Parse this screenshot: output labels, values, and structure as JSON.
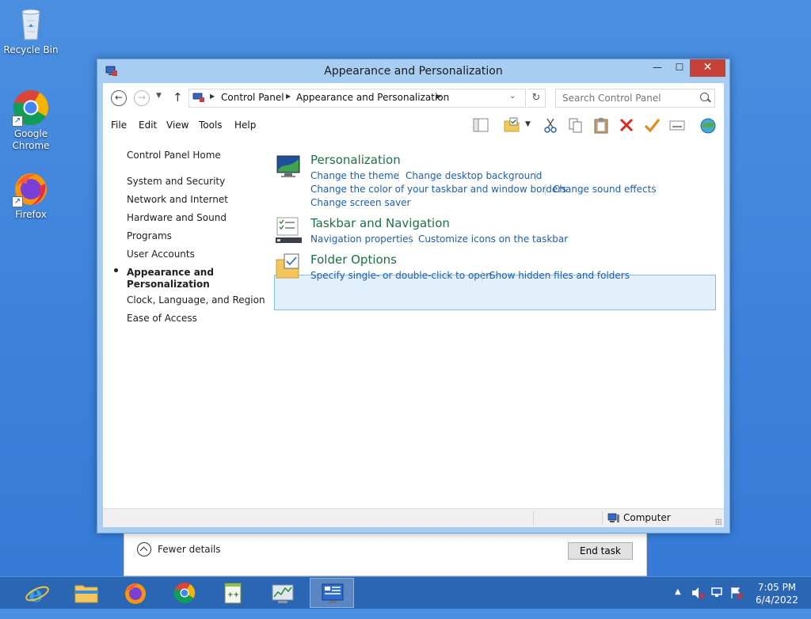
{
  "desktop": {
    "icons": [
      {
        "label": "Recycle Bin"
      },
      {
        "label": "Google Chrome"
      },
      {
        "label": "Firefox"
      }
    ]
  },
  "window": {
    "title": "Appearance and Personalization",
    "buttons": {
      "minimize": "—",
      "maximize": "☐",
      "close": "✕"
    }
  },
  "address": {
    "crumbs": [
      "Control Panel",
      "Appearance and Personalization"
    ],
    "search_placeholder": "Search Control Panel"
  },
  "menu": [
    "File",
    "Edit",
    "View",
    "Tools",
    "Help"
  ],
  "toolbar_icons": [
    "layout-pane-icon",
    "folder-check-icon",
    "dropdown-icon",
    "cut-icon",
    "copy-icon",
    "paste-icon",
    "delete-icon",
    "check-icon",
    "properties-icon",
    "globe-icon"
  ],
  "leftnav": {
    "home": "Control Panel Home",
    "items": [
      "System and Security",
      "Network and Internet",
      "Hardware and Sound",
      "Programs",
      "User Accounts",
      "Appearance and Personalization",
      "Clock, Language, and Region",
      "Ease of Access"
    ],
    "current_index": 5
  },
  "categories": [
    {
      "title": "Personalization",
      "icon": "personalization-icon",
      "links": [
        "Change the theme",
        "Change desktop background",
        "Change the color of your taskbar and window borders",
        "Change sound effects",
        "Change screen saver"
      ]
    },
    {
      "title": "Taskbar and Navigation",
      "icon": "taskbar-icon",
      "links": [
        "Navigation properties",
        "Customize icons on the taskbar"
      ]
    },
    {
      "title": "Folder Options",
      "icon": "folder-options-icon",
      "links": [
        "Specify single- or double-click to open",
        "Show hidden files and folders"
      ],
      "highlighted": true
    }
  ],
  "statusbar": {
    "location": "Computer"
  },
  "taskmanager": {
    "fewer_details": "Fewer details",
    "end_task": "End task"
  },
  "taskbar": {
    "apps": [
      "internet-explorer-icon",
      "file-explorer-icon",
      "firefox-icon",
      "chrome-icon",
      "notepad-plus-plus-icon",
      "task-manager-icon",
      "control-panel-icon"
    ],
    "active_app": "control-panel-icon",
    "clock_time": "7:05 PM",
    "clock_date": "6/4/2022"
  },
  "colors": {
    "link": "#1f5fa6",
    "category_title": "#1e7145",
    "close_button": "#c7403a",
    "taskbar": "#2a66b3"
  }
}
